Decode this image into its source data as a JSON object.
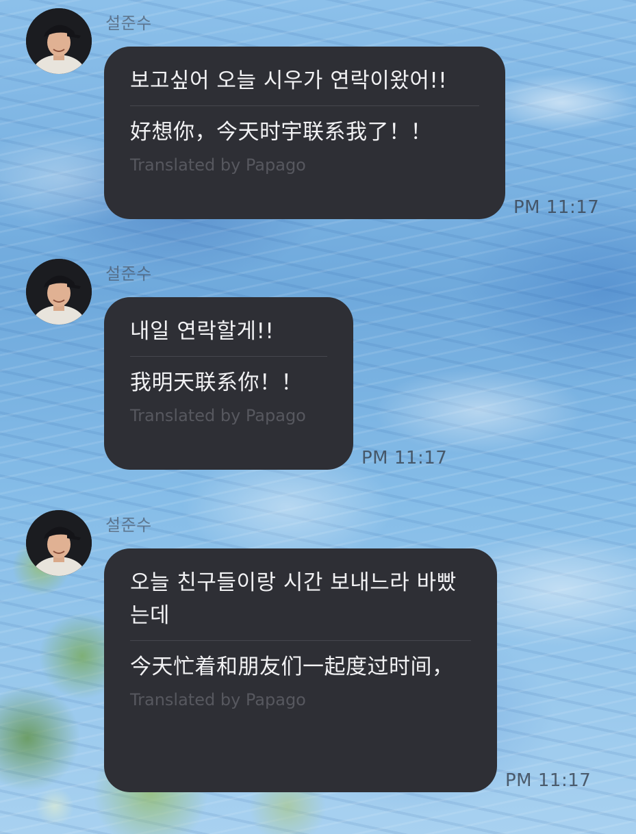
{
  "colors": {
    "bubble": "#2e2f35",
    "bubble_text": "#f2f2f4",
    "divider": "#46474e",
    "translation_credit": "#57585f",
    "timestamp": "#3c4655"
  },
  "messages": [
    {
      "sender": "설준수",
      "avatar_icon": "profile-photo",
      "original": "보고싶어 오늘 시우가 연락이왔어!!",
      "translation": "好想你，今天时宇联系我了！！",
      "translated_by": "Translated by Papago",
      "time": "PM 11:17"
    },
    {
      "sender": "설준수",
      "avatar_icon": "profile-photo",
      "original": "내일 연락할게!!",
      "translation": "我明天联系你！！",
      "translated_by": "Translated by Papago",
      "time": "PM 11:17"
    },
    {
      "sender": "설준수",
      "avatar_icon": "profile-photo",
      "original": "오늘 친구들이랑 시간 보내느라 바빴는데",
      "translation": "今天忙着和朋友们一起度过时间，",
      "translated_by": "Translated by Papago",
      "time": "PM 11:17"
    }
  ]
}
